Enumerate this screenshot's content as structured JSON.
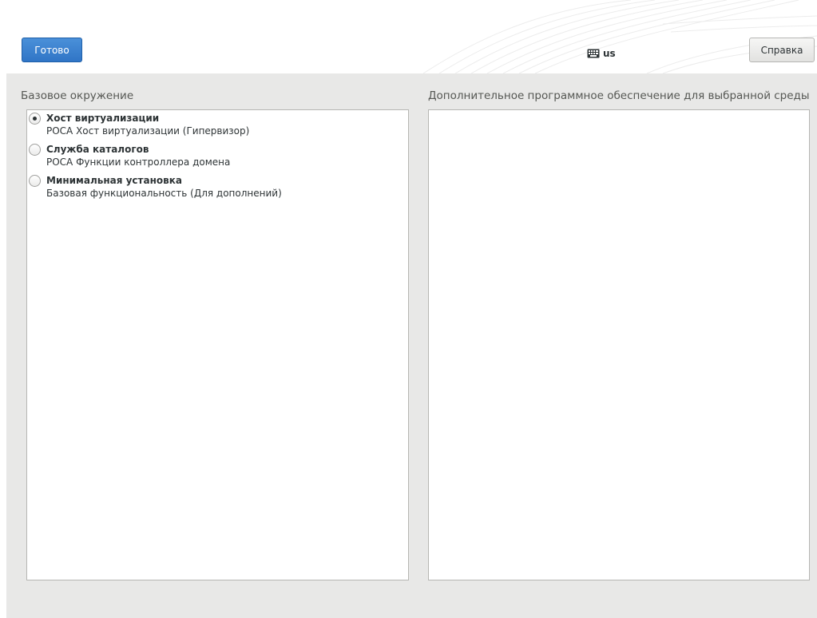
{
  "header": {
    "done_label": "Готово",
    "help_label": "Справка",
    "keyboard_layout": "us",
    "keyboard_icon": "keyboard-icon"
  },
  "main": {
    "base_env_label": "Базовое окружение",
    "addons_label": "Дополнительное программное обеспечение для выбранной среды",
    "environments": [
      {
        "title": "Хост виртуализации",
        "description": "РОСА Хост виртуализации (Гипервизор)",
        "selected": true
      },
      {
        "title": "Служба каталогов",
        "description": "РОСА Функции контроллера домена",
        "selected": false
      },
      {
        "title": "Минимальная установка",
        "description": "Базовая функциональность (Для дополнений)",
        "selected": false
      }
    ],
    "addons": []
  },
  "colors": {
    "accent": "#3b83cf",
    "content_bg": "#e8e8e7",
    "panel_border": "#b6b6b3"
  }
}
